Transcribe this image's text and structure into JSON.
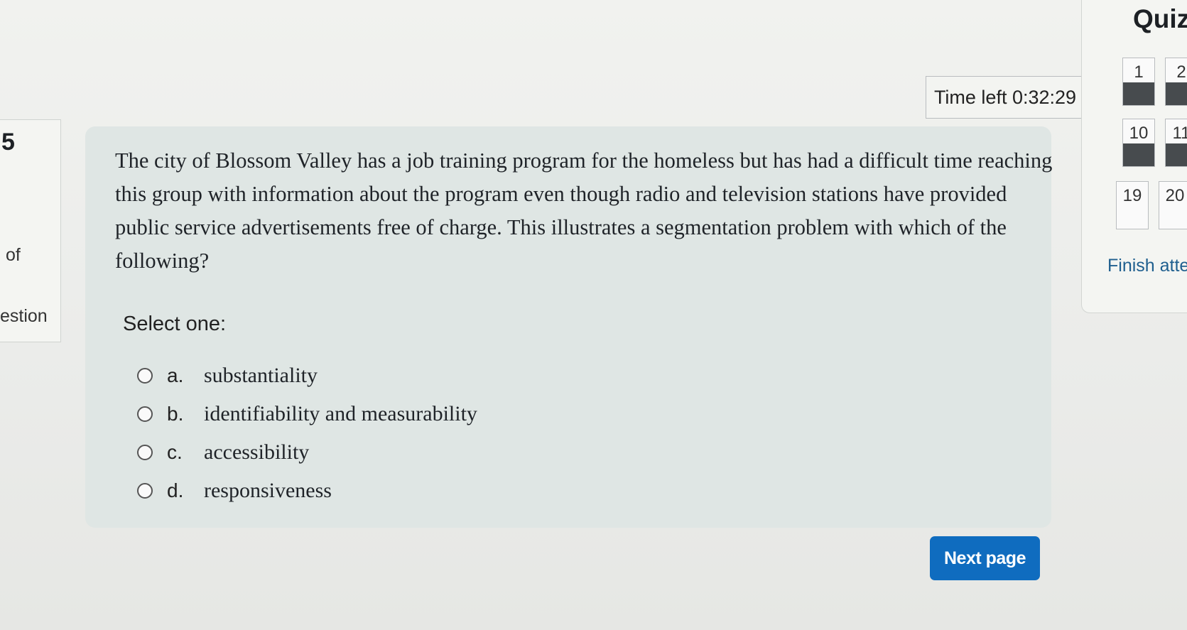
{
  "question_info": {
    "number": "5",
    "of_text": "of",
    "label_text": "estion"
  },
  "timer": {
    "text": "Time left 0:32:29"
  },
  "question": {
    "text": "The city of Blossom Valley has a job training program for the homeless but has had a difficult time reaching this group with information about the program even though radio and television stations have provided public service advertisements free of charge. This illustrates a segmentation problem with which of the following?",
    "prompt": "Select one:",
    "answers": [
      {
        "letter": "a.",
        "text": "substantiality"
      },
      {
        "letter": "b.",
        "text": "identifiability and measurability"
      },
      {
        "letter": "c.",
        "text": "accessibility"
      },
      {
        "letter": "d.",
        "text": "responsiveness"
      }
    ]
  },
  "next_button": {
    "label": "Next page"
  },
  "quiz_nav": {
    "title": "Quiz",
    "buttons": [
      {
        "label": "1",
        "answered": true
      },
      {
        "label": "2",
        "answered": true
      },
      {
        "label": "10",
        "answered": true
      },
      {
        "label": "11",
        "answered": true
      },
      {
        "label": "19",
        "answered": false
      },
      {
        "label": "20",
        "answered": false
      }
    ],
    "finish_link": "Finish atte"
  },
  "colors": {
    "accent": "#0f6cbf",
    "card_background": "#dfe6e4",
    "answered_fill": "#474b4e"
  }
}
